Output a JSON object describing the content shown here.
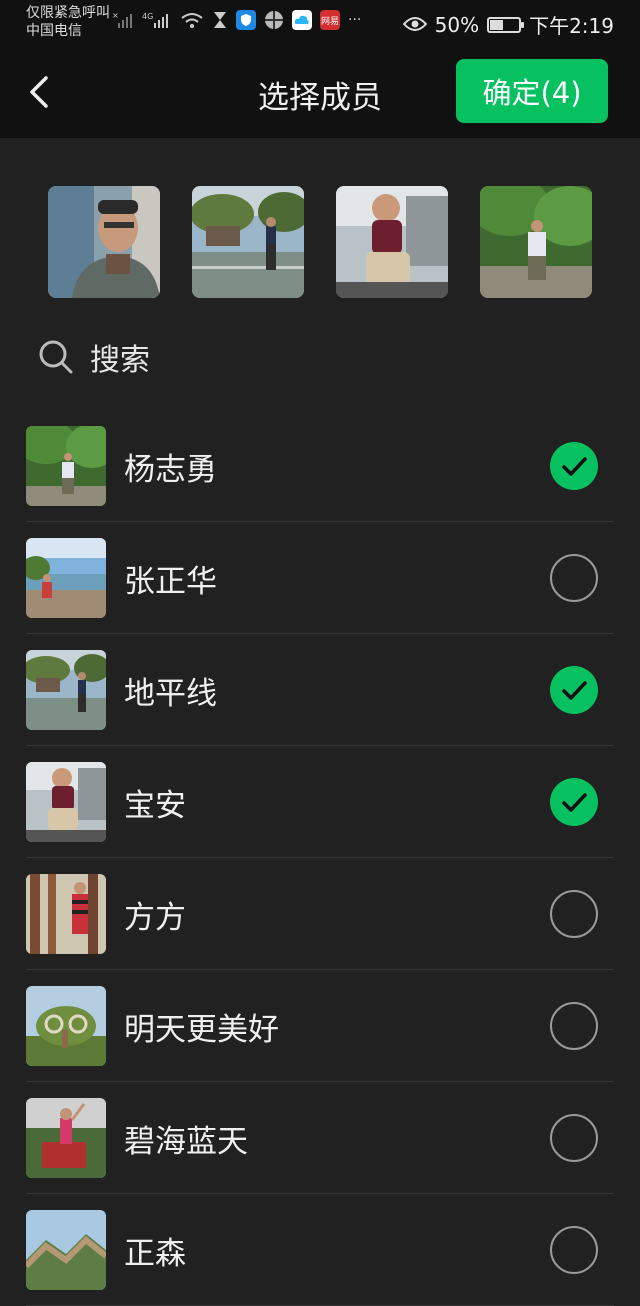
{
  "status_bar": {
    "carrier_line1": "仅限紧急呼叫",
    "carrier_line2": "中国电信",
    "network": "4G",
    "app_badge_text": "网易",
    "more": "···",
    "battery_text": "50%",
    "battery_level": 0.5,
    "time": "下午2:19"
  },
  "header": {
    "title": "选择成员",
    "confirm_label": "确定(4)"
  },
  "search": {
    "placeholder": "搜索"
  },
  "selected_members": [
    {
      "name": "avatar-man-glasses"
    },
    {
      "name": "avatar-lakeside"
    },
    {
      "name": "avatar-toddler"
    },
    {
      "name": "avatar-man-trees"
    }
  ],
  "contacts": [
    {
      "name": "杨志勇",
      "checked": true
    },
    {
      "name": "张正华",
      "checked": false
    },
    {
      "name": "地平线",
      "checked": true
    },
    {
      "name": "宝安",
      "checked": true
    },
    {
      "name": "方方",
      "checked": false
    },
    {
      "name": "明天更美好",
      "checked": false
    },
    {
      "name": "碧海蓝天",
      "checked": false
    },
    {
      "name": "正森",
      "checked": false
    }
  ],
  "colors": {
    "accent": "#07c160",
    "background": "#212121",
    "header_bg": "#111111"
  }
}
